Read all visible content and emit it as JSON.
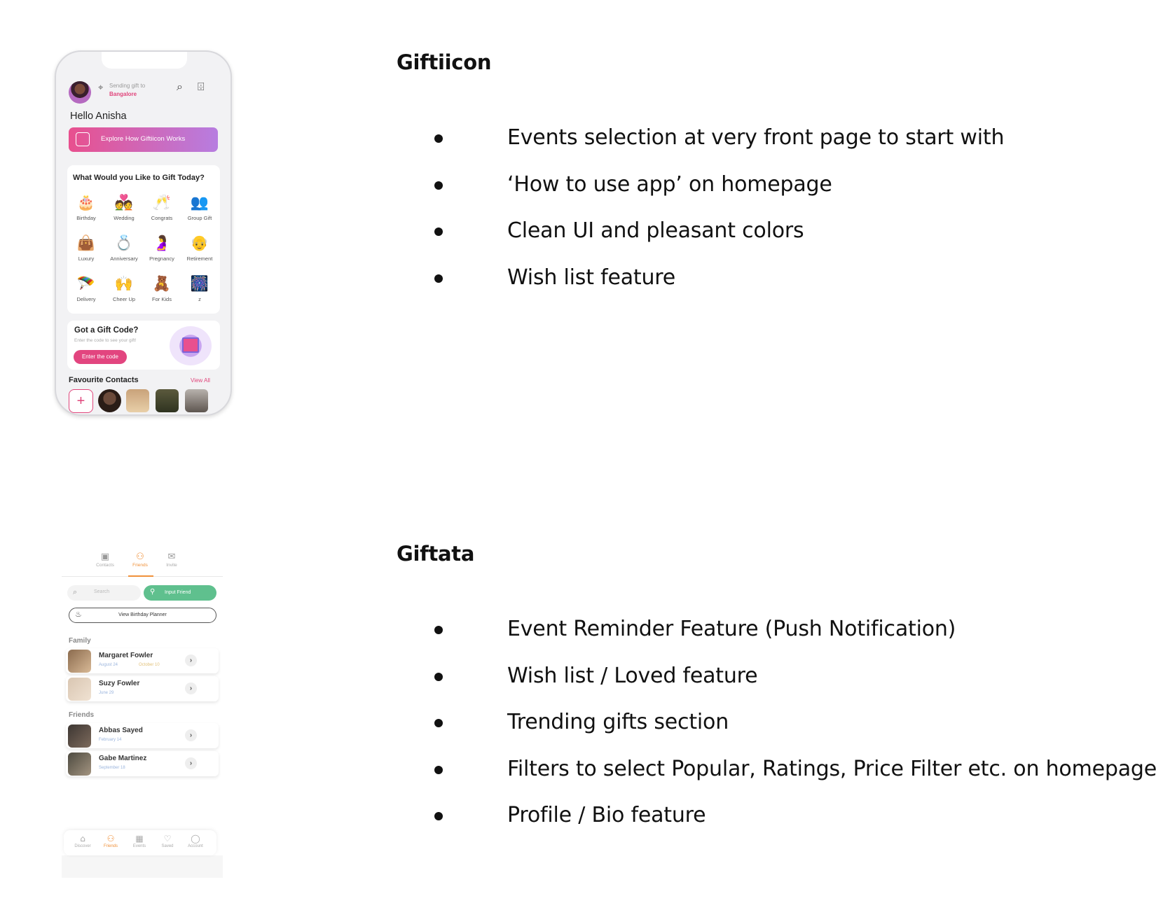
{
  "sections": [
    {
      "title": "Giftiicon",
      "bullets": [
        "Events selection at very front page to start with",
        "‘How to use app’ on homepage",
        "Clean UI and pleasant colors",
        "Wish list feature"
      ]
    },
    {
      "title": "Giftata",
      "bullets": [
        "Event Reminder Feature (Push Notification)",
        "Wish list / Loved feature",
        "Trending gifts section",
        "Filters to select Popular, Ratings, Price Filter etc. on homepage",
        "Profile / Bio feature"
      ]
    }
  ],
  "giftiicon_screen": {
    "sending_label": "Sending gift to",
    "city": "Bangalore",
    "hello_prefix": "Hello",
    "user_name": "Anisha",
    "explore_label": "Explore How Giftiicon Works",
    "question": "What Would you Like to Gift Today?",
    "categories": [
      {
        "label": "Birthday",
        "icon": "cake-icon",
        "glyph": "🎂"
      },
      {
        "label": "Wedding",
        "icon": "wedding-icon",
        "glyph": "💑"
      },
      {
        "label": "Congrats",
        "icon": "cheers-icon",
        "glyph": "🥂"
      },
      {
        "label": "Group Gift",
        "icon": "group-icon",
        "glyph": "👥"
      },
      {
        "label": "Luxury",
        "icon": "shopping-bag-icon",
        "glyph": "👜"
      },
      {
        "label": "Anniversary",
        "icon": "rings-icon",
        "glyph": "💍"
      },
      {
        "label": "Pregnancy",
        "icon": "pregnancy-icon",
        "glyph": "🤰"
      },
      {
        "label": "Retirement",
        "icon": "grandpa-icon",
        "glyph": "👴"
      },
      {
        "label": "Delivery",
        "icon": "parachute-gift-icon",
        "glyph": "🪂"
      },
      {
        "label": "Cheer Up",
        "icon": "high-five-icon",
        "glyph": "🙌"
      },
      {
        "label": "For Kids",
        "icon": "teddy-bear-icon",
        "glyph": "🧸"
      },
      {
        "label": "z",
        "icon": "fireworks-icon",
        "glyph": "🎆"
      }
    ],
    "gift_code_title": "Got a Gift Code?",
    "gift_code_sub": "Enter the code to see your gift!",
    "gift_code_button": "Enter the code",
    "favourites_title": "Favourite Contacts",
    "view_all": "View All",
    "add_symbol": "+",
    "colors": {
      "accent": "#e0457b",
      "gradient_start": "#e8508e",
      "gradient_end": "#b77de0"
    }
  },
  "giftata_screen": {
    "top_tabs": [
      {
        "label": "Contacts",
        "icon": "contacts-icon",
        "glyph": "▣"
      },
      {
        "label": "Friends",
        "icon": "friends-icon",
        "glyph": "⚇"
      },
      {
        "label": "Invite",
        "icon": "invite-envelope-icon",
        "glyph": "✉"
      }
    ],
    "search_placeholder": "Search",
    "input_friend_label": "Input Friend",
    "planner_label": "View Birthday Planner",
    "groups": [
      {
        "name": "Family",
        "people": [
          {
            "name": "Margaret Fowler",
            "date1": "August 24",
            "date2": "October 10"
          },
          {
            "name": "Suzy Fowler",
            "date1": "June 29",
            "date2": ""
          }
        ]
      },
      {
        "name": "Friends",
        "people": [
          {
            "name": "Abbas Sayed",
            "date1": "February 14",
            "date2": ""
          },
          {
            "name": "Gabe Martinez",
            "date1": "September 18",
            "date2": ""
          }
        ]
      }
    ],
    "bottom_nav": [
      {
        "label": "Discover",
        "icon": "gift-icon",
        "glyph": "⌂"
      },
      {
        "label": "Friends",
        "icon": "friends-icon",
        "glyph": "⚇"
      },
      {
        "label": "Events",
        "icon": "calendar-icon",
        "glyph": "▦"
      },
      {
        "label": "Saved",
        "icon": "heart-icon",
        "glyph": "♡"
      },
      {
        "label": "Account",
        "icon": "user-icon",
        "glyph": "◯"
      }
    ],
    "colors": {
      "active": "#f0913a",
      "input_friend": "#5fc08e"
    }
  }
}
